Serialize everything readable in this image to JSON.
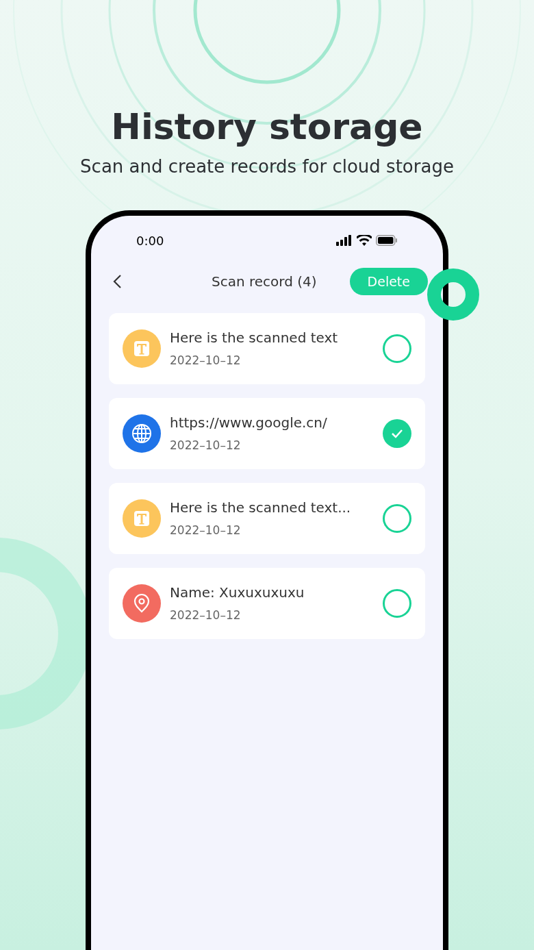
{
  "headline": "History storage",
  "subtitle": "Scan and create records for cloud storage",
  "status_bar": {
    "time": "0:00"
  },
  "nav": {
    "title": "Scan record (4)",
    "action": "Delete"
  },
  "records": [
    {
      "kind": "text",
      "title": "Here is the scanned text",
      "date": "2022–10–12",
      "selected": false
    },
    {
      "kind": "web",
      "title": "https://www.google.cn/",
      "date": "2022–10–12",
      "selected": true
    },
    {
      "kind": "text",
      "title": "Here is the scanned text...",
      "date": "2022–10–12",
      "selected": false
    },
    {
      "kind": "location",
      "title": "Name: Xuxuxuxuxu",
      "date": "2022–10–12",
      "selected": false
    }
  ]
}
